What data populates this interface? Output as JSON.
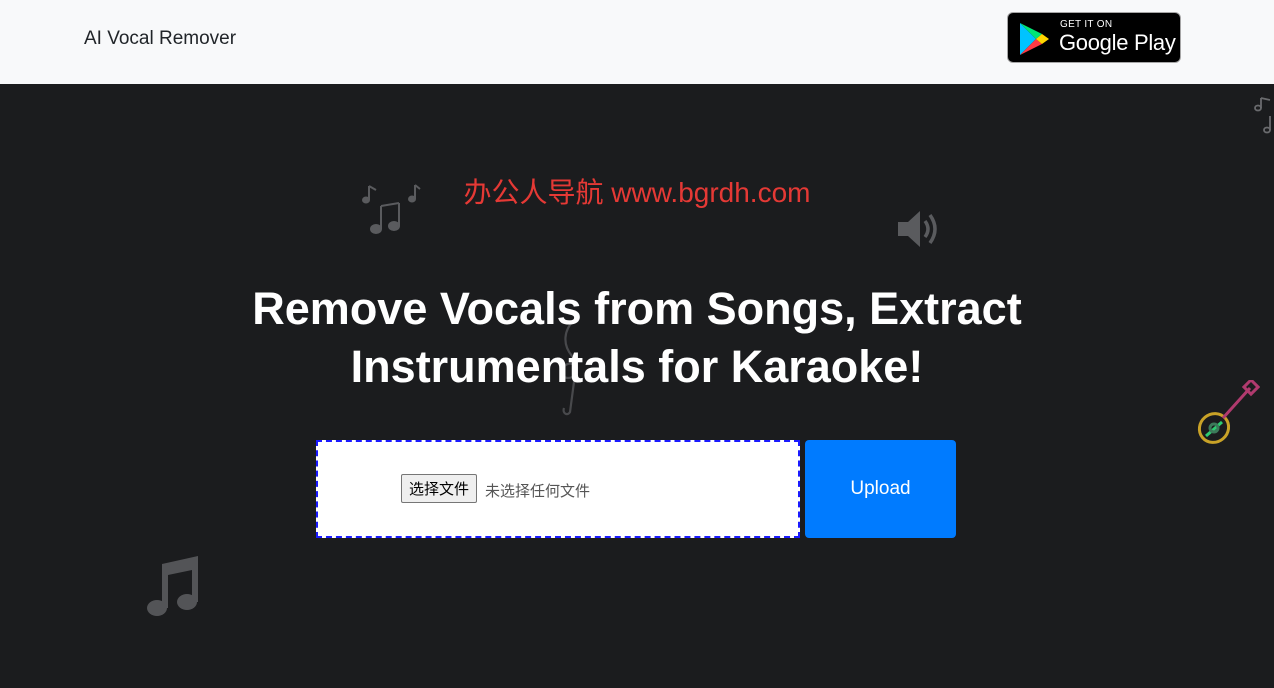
{
  "header": {
    "brand": "AI Vocal Remover",
    "store_badge": {
      "top_text": "GET IT ON",
      "main_text": "Google Play",
      "icon": "google-play-icon"
    }
  },
  "hero": {
    "watermark": "办公人导航 www.bgrdh.com",
    "headline_line1": "Remove Vocals from Songs, Extract",
    "headline_line2": "Instrumentals for Karaoke!",
    "file_input": {
      "button_label": "选择文件",
      "status_text": "未选择任何文件"
    },
    "upload_label": "Upload"
  },
  "decorations": [
    "music-notes-icon",
    "speaker-icon",
    "treble-clef-icon",
    "guitar-icon",
    "music-note-icon"
  ],
  "colors": {
    "background": "#1b1c1e",
    "topbar": "#f8f9fa",
    "accent": "#007bff",
    "watermark": "#e53935",
    "dropzone_border": "#1a1aff"
  }
}
